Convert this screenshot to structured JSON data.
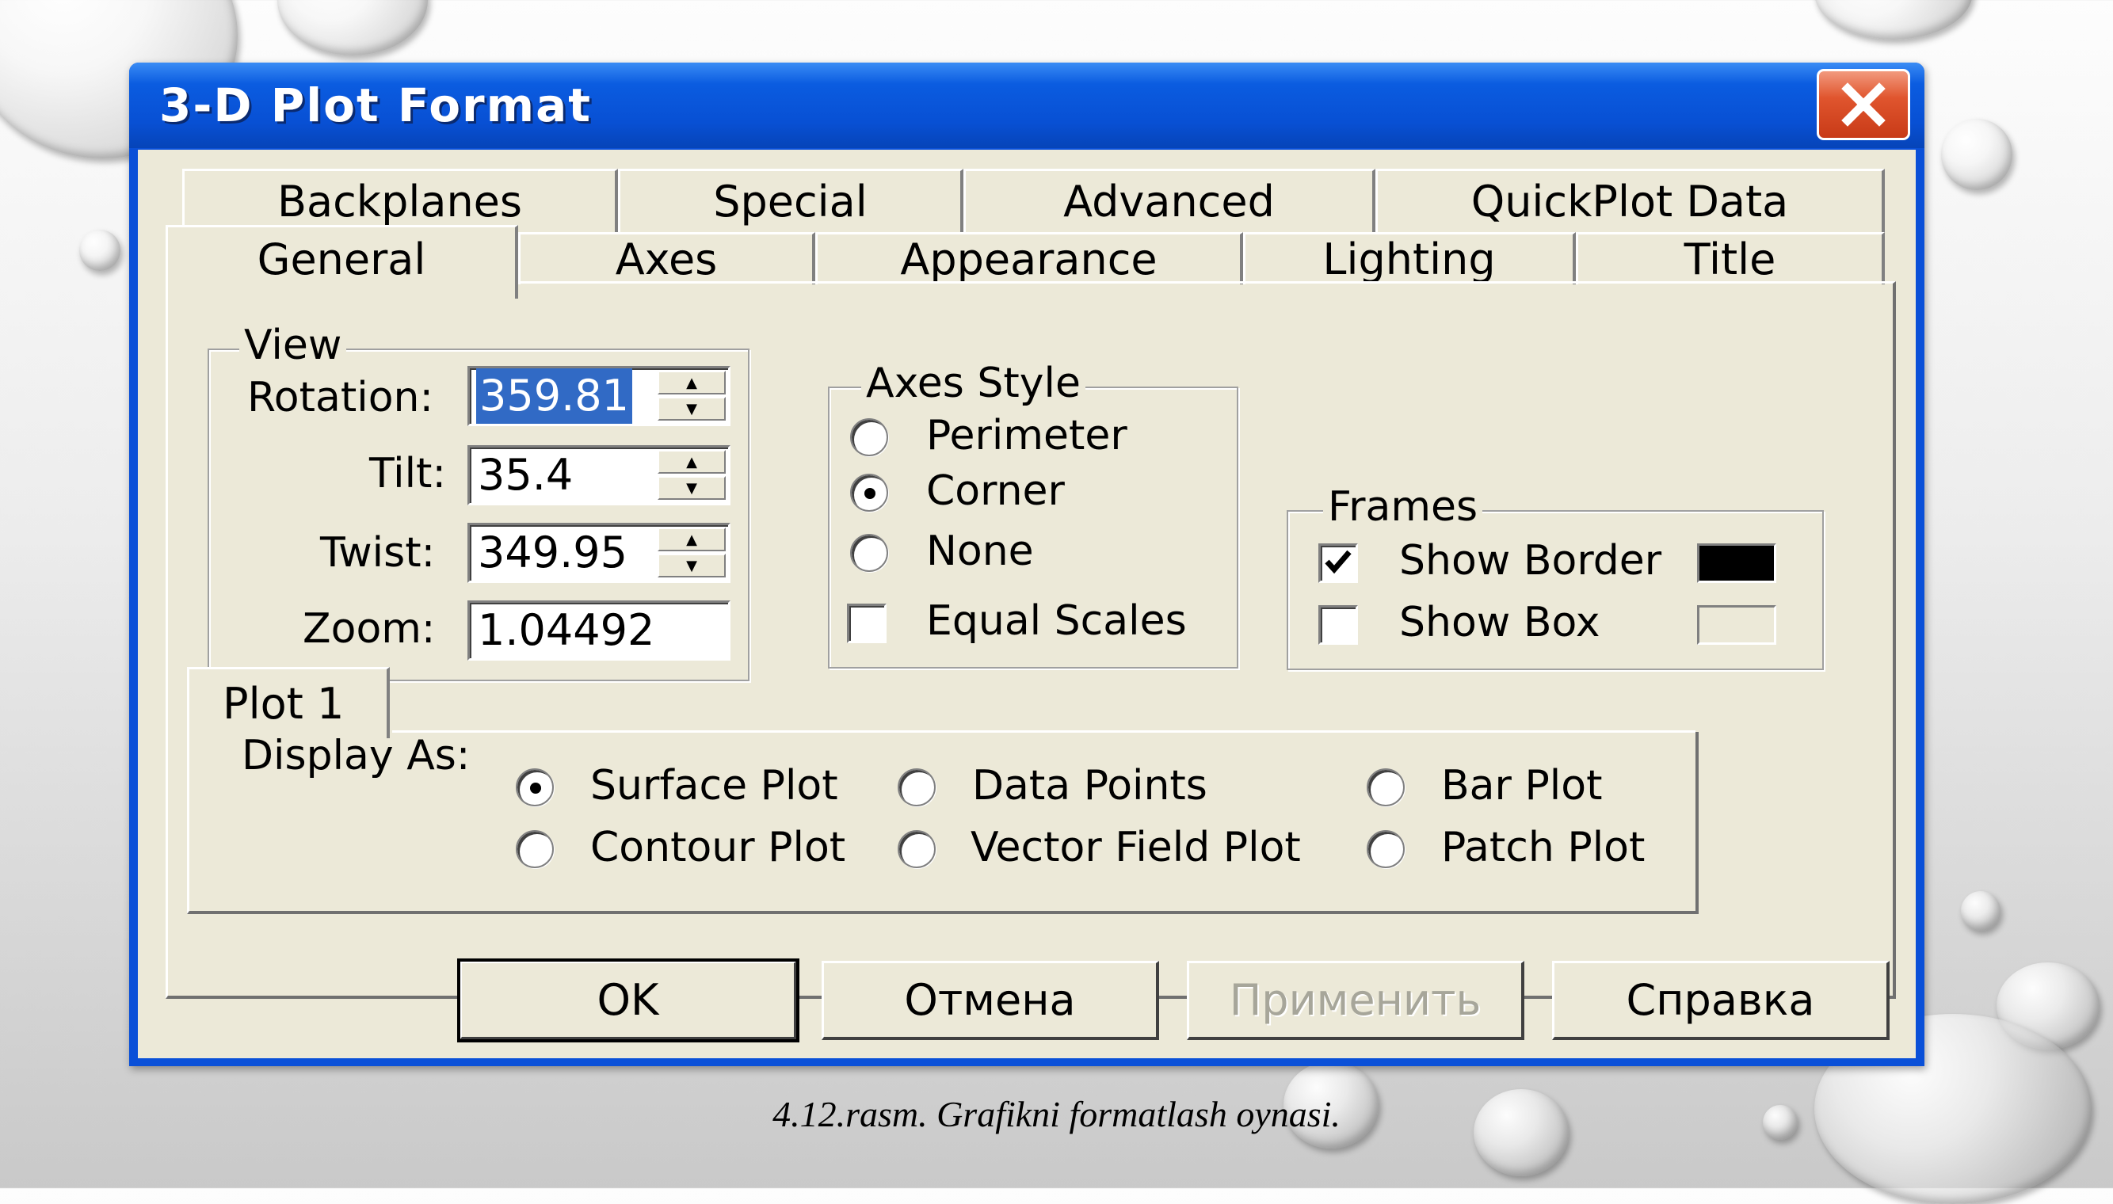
{
  "window": {
    "title": "3-D Plot Format"
  },
  "tabs": {
    "row1": [
      "Backplanes",
      "Special",
      "Advanced",
      "QuickPlot Data"
    ],
    "row2": [
      "General",
      "Axes",
      "Appearance",
      "Lighting",
      "Title"
    ],
    "active": "General"
  },
  "view": {
    "group_label": "View",
    "rotation": {
      "label": "Rotation:",
      "value": "359.81"
    },
    "tilt": {
      "label": "Tilt:",
      "value": "35.4"
    },
    "twist": {
      "label": "Twist:",
      "value": "349.95"
    },
    "zoom": {
      "label": "Zoom:",
      "value": "1.04492"
    }
  },
  "axes_style": {
    "group_label": "Axes Style",
    "options": [
      "Perimeter",
      "Corner",
      "None"
    ],
    "selected": "Corner",
    "equal_scales": {
      "label": "Equal Scales",
      "checked": false
    }
  },
  "frames": {
    "group_label": "Frames",
    "show_border": {
      "label": "Show Border",
      "checked": true,
      "color": "#000000"
    },
    "show_box": {
      "label": "Show Box",
      "checked": false,
      "color": "#ece9d8"
    }
  },
  "plot_tab": {
    "label": "Plot 1",
    "display_as_label": "Display As:",
    "options": [
      "Surface Plot",
      "Data Points",
      "Bar Plot",
      "Contour Plot",
      "Vector Field Plot",
      "Patch Plot"
    ],
    "selected": "Surface Plot"
  },
  "buttons": {
    "ok": "OK",
    "cancel": "Отмена",
    "apply": "Применить",
    "help": "Справка"
  },
  "caption": "4.12.rasm. Grafikni formatlash oynasi."
}
